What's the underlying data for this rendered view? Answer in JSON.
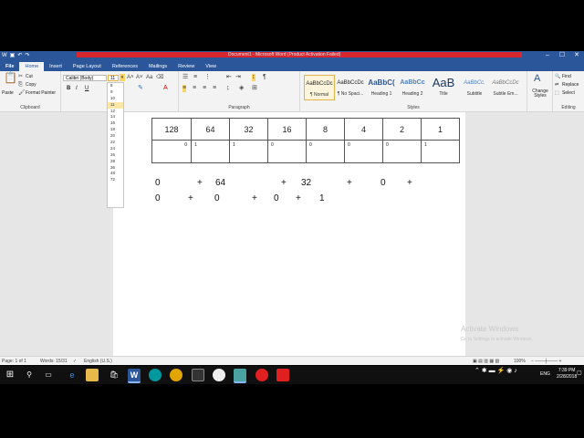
{
  "window": {
    "title": "Document1 - Microsoft Word (Product Activation Failed)",
    "minimize": "–",
    "maximize": "☐",
    "close": "✕"
  },
  "tabs": [
    "File",
    "Home",
    "Insert",
    "Page Layout",
    "References",
    "Mailings",
    "Review",
    "View"
  ],
  "active_tab": "Home",
  "clipboard": {
    "paste": "Paste",
    "cut": "Cut",
    "copy": "Copy",
    "format_painter": "Format Painter",
    "group": "Clipboard"
  },
  "font": {
    "name": "Calibri (Body)",
    "size": "11",
    "bold": "B",
    "italic": "I",
    "underline": "U"
  },
  "font_sizes": [
    "8",
    "9",
    "10",
    "11",
    "12",
    "14",
    "16",
    "18",
    "20",
    "22",
    "24",
    "26",
    "28",
    "36",
    "48",
    "72"
  ],
  "paragraph_group": "Paragraph",
  "styles": [
    {
      "preview": "AaBbCcDc",
      "name": "¶ Normal"
    },
    {
      "preview": "AaBbCcDc",
      "name": "¶ No Spaci..."
    },
    {
      "preview": "AaBbC(",
      "name": "Heading 1"
    },
    {
      "preview": "AaBbCc",
      "name": "Heading 2"
    },
    {
      "preview": "AaB",
      "name": "Title"
    },
    {
      "preview": "AaBbCc.",
      "name": "Subtitle"
    },
    {
      "preview": "AaBbCcDc",
      "name": "Subtle Em..."
    }
  ],
  "styles_group": "Styles",
  "change_styles": "Change Styles",
  "editing": {
    "find": "Find",
    "replace": "Replace",
    "select": "Select",
    "group": "Editing"
  },
  "table": {
    "headers": [
      "128",
      "64",
      "32",
      "16",
      "8",
      "4",
      "2",
      "1"
    ],
    "values": [
      "0",
      "1",
      "1",
      "0",
      "0",
      "0",
      "0",
      "1"
    ]
  },
  "sum_line1": [
    "0",
    "+",
    "64",
    "+",
    "32",
    "+",
    "0",
    "+"
  ],
  "sum_line2": [
    "0",
    "+",
    "0",
    "+",
    "0",
    "+",
    "1"
  ],
  "watermark": {
    "line1": "Activate Windows",
    "line2": "Go to Settings to activate Windows."
  },
  "status": {
    "page": "Page: 1 of 1",
    "words": "Words: 15/31",
    "language": "English (U.S.)",
    "zoom": "100%"
  },
  "clock": {
    "time": "7:39 PM",
    "date": "2/28/2018",
    "lang": "ENG"
  },
  "colors": {
    "word_blue": "#2b579a",
    "ribbon": "#f3f3f3",
    "taskbar": "#101010"
  }
}
